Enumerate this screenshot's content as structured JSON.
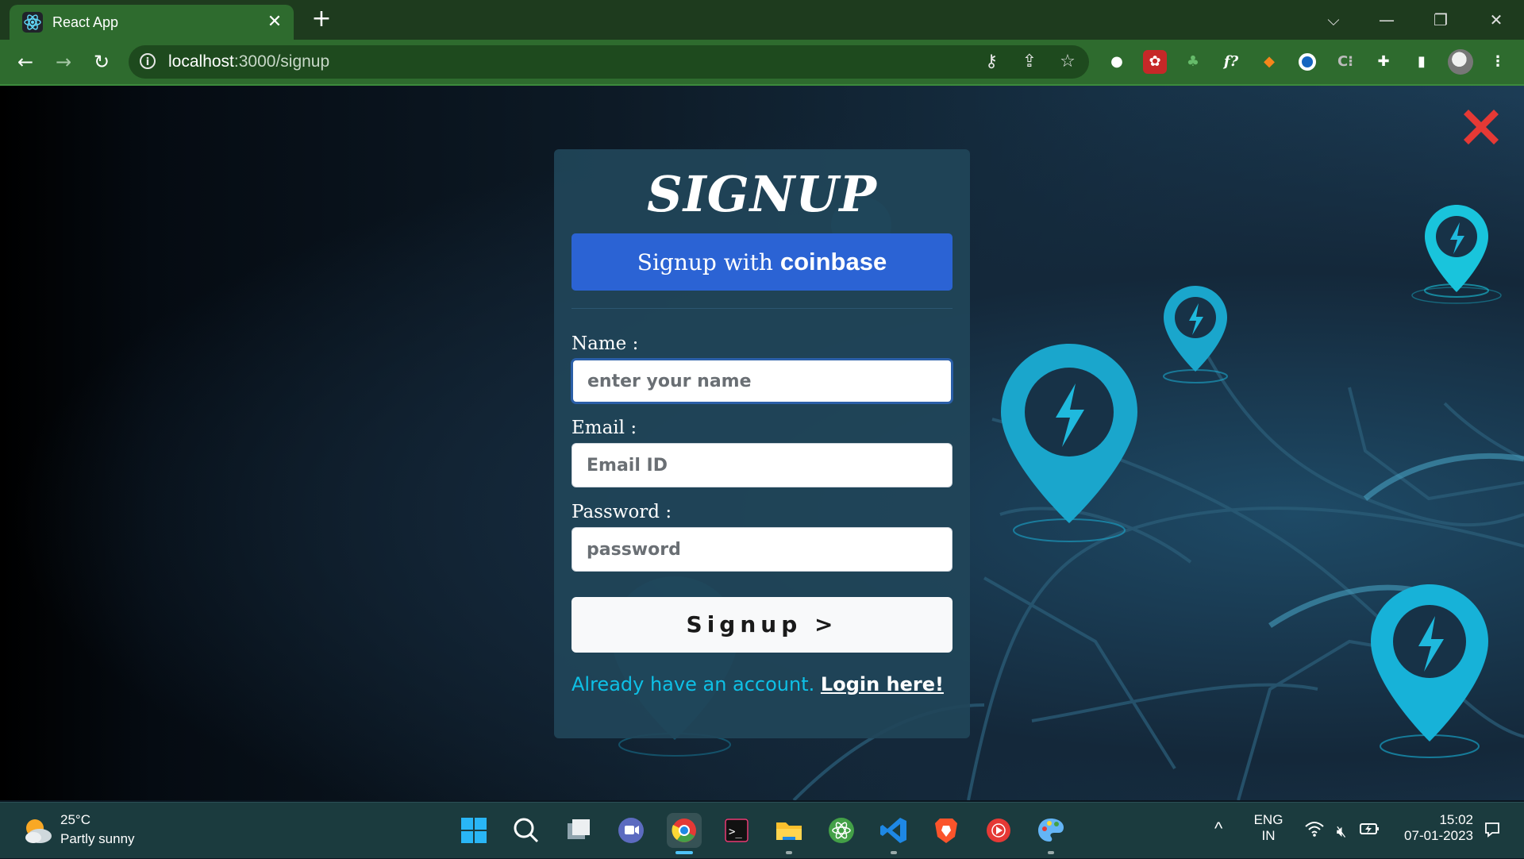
{
  "browser": {
    "tab_title": "React App",
    "tab_close": "✕",
    "new_tab": "+",
    "url_host": "localhost",
    "url_path": ":3000/signup",
    "window_controls": [
      "⌵",
      "—",
      "❐",
      "✕"
    ],
    "toolbar_icons": [
      "back-icon",
      "forward-icon",
      "reload-icon",
      "key-icon",
      "share-icon",
      "star-icon",
      "extensions-icon",
      "sidepanel-icon",
      "menu-icon"
    ],
    "extensions": [
      {
        "name": "extension-grey-icon",
        "glyph": "●",
        "bg": "#6b6b6b"
      },
      {
        "name": "extension-red-icon",
        "glyph": "✿",
        "bg": "#c62828"
      },
      {
        "name": "extension-tree-icon",
        "glyph": "♣",
        "bg": "#2e7d32"
      },
      {
        "name": "extension-fx-icon",
        "glyph": "f?",
        "bg": "transparent"
      },
      {
        "name": "extension-metamask-icon",
        "glyph": "◆",
        "bg": "#e2761b"
      },
      {
        "name": "extension-blue-ring-icon",
        "glyph": "◉",
        "bg": "#1565c0"
      },
      {
        "name": "extension-c-icon",
        "glyph": "C⁝",
        "bg": "transparent"
      }
    ]
  },
  "page": {
    "close_icon": "close-icon",
    "accent_close": "#e53935",
    "title": "SIGNUP",
    "coinbase_prefix": "Signup with ",
    "coinbase_brand": "coinbase",
    "fields": {
      "name": {
        "label": "Name :",
        "placeholder": "enter your name",
        "value": ""
      },
      "email": {
        "label": "Email :",
        "placeholder": "Email ID",
        "value": ""
      },
      "password": {
        "label": "Password :",
        "placeholder": "password",
        "value": ""
      }
    },
    "signup_button": "Signup >",
    "login_prompt": "Already have an account. ",
    "login_link": "Login here!",
    "colors": {
      "card": "#214559",
      "coinbase_blue": "#2b63d4",
      "link_cyan": "#0ec0e6",
      "pin": "#1eb6d6"
    }
  },
  "taskbar": {
    "weather_temp": "25°C",
    "weather_desc": "Partly sunny",
    "apps": [
      "start-icon",
      "search-icon",
      "task-view-icon",
      "teams-icon",
      "chrome-icon",
      "terminal-icon",
      "file-explorer-icon",
      "atom-icon",
      "vscode-icon",
      "brave-icon",
      "youtube-music-icon",
      "paint-icon"
    ],
    "tray_chevron": "^",
    "lang_top": "ENG",
    "lang_bottom": "IN",
    "time": "15:02",
    "date": "07-01-2023"
  }
}
